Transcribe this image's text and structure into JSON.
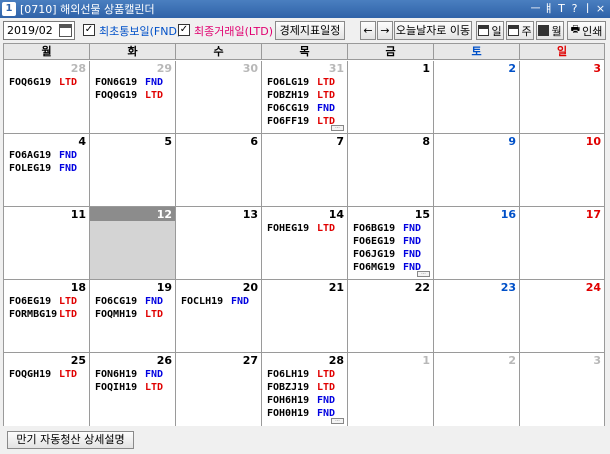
{
  "window": {
    "number": "1",
    "title": "[0710] 해외선물 상품캘린더",
    "controls": [
      "ㅡ",
      "ㅒ",
      "T",
      "?",
      "ㅣ",
      "×"
    ]
  },
  "toolbar": {
    "date_value": "2019/02",
    "fnd_checkbox": {
      "checked": true,
      "label": "최초통보일(FND)"
    },
    "ltd_checkbox": {
      "checked": true,
      "label": "최종거래일(LTD)"
    },
    "economic_button": "경제지표일정",
    "prev_button": "←",
    "next_button": "→",
    "today_button": "오늘날자로 이동",
    "day_button": "일",
    "week_button": "주",
    "month_button": "월",
    "print_button": "인쇄"
  },
  "colors": {
    "sunday": "#e00000",
    "saturday": "#0050c8",
    "ltd": "#e00000",
    "fnd": "#0000e0"
  },
  "weekdays": [
    "월",
    "화",
    "수",
    "목",
    "금",
    "토",
    "일"
  ],
  "weeks": [
    [
      {
        "day": "28",
        "other": true,
        "events": [
          {
            "code": "FOQ6G19",
            "type": "LTD"
          }
        ]
      },
      {
        "day": "29",
        "other": true,
        "events": [
          {
            "code": "FON6G19",
            "type": "FND"
          },
          {
            "code": "FOQ0G19",
            "type": "LTD"
          }
        ]
      },
      {
        "day": "30",
        "other": true,
        "events": []
      },
      {
        "day": "31",
        "other": true,
        "more": true,
        "events": [
          {
            "code": "FO6LG19",
            "type": "LTD"
          },
          {
            "code": "FOBZH19",
            "type": "LTD"
          },
          {
            "code": "FO6CG19",
            "type": "FND"
          },
          {
            "code": "FO6FF19",
            "type": "LTD"
          }
        ]
      },
      {
        "day": "1",
        "events": []
      },
      {
        "day": "2",
        "events": []
      },
      {
        "day": "3",
        "events": []
      }
    ],
    [
      {
        "day": "4",
        "events": [
          {
            "code": "FO6AG19",
            "type": "FND"
          },
          {
            "code": "FOLEG19",
            "type": "FND"
          }
        ]
      },
      {
        "day": "5",
        "events": []
      },
      {
        "day": "6",
        "events": []
      },
      {
        "day": "7",
        "events": []
      },
      {
        "day": "8",
        "events": []
      },
      {
        "day": "9",
        "events": []
      },
      {
        "day": "10",
        "events": []
      }
    ],
    [
      {
        "day": "11",
        "events": []
      },
      {
        "day": "12",
        "today": true,
        "events": []
      },
      {
        "day": "13",
        "events": []
      },
      {
        "day": "14",
        "events": [
          {
            "code": "FOHEG19",
            "type": "LTD"
          }
        ]
      },
      {
        "day": "15",
        "more": true,
        "events": [
          {
            "code": "FO6BG19",
            "type": "FND"
          },
          {
            "code": "FO6EG19",
            "type": "FND"
          },
          {
            "code": "FO6JG19",
            "type": "FND"
          },
          {
            "code": "FO6MG19",
            "type": "FND"
          }
        ]
      },
      {
        "day": "16",
        "events": []
      },
      {
        "day": "17",
        "events": []
      }
    ],
    [
      {
        "day": "18",
        "events": [
          {
            "code": "FO6EG19",
            "type": "LTD"
          },
          {
            "code": "FORMBG19",
            "type": "LTD"
          }
        ]
      },
      {
        "day": "19",
        "events": [
          {
            "code": "FO6CG19",
            "type": "FND"
          },
          {
            "code": "FOQMH19",
            "type": "LTD"
          }
        ]
      },
      {
        "day": "20",
        "events": [
          {
            "code": "FOCLH19",
            "type": "FND"
          }
        ]
      },
      {
        "day": "21",
        "events": []
      },
      {
        "day": "22",
        "events": []
      },
      {
        "day": "23",
        "events": []
      },
      {
        "day": "24",
        "events": []
      }
    ],
    [
      {
        "day": "25",
        "events": [
          {
            "code": "FOQGH19",
            "type": "LTD"
          }
        ]
      },
      {
        "day": "26",
        "events": [
          {
            "code": "FON6H19",
            "type": "FND"
          },
          {
            "code": "FOQIH19",
            "type": "LTD"
          }
        ]
      },
      {
        "day": "27",
        "events": []
      },
      {
        "day": "28",
        "more": true,
        "events": [
          {
            "code": "FO6LH19",
            "type": "LTD"
          },
          {
            "code": "FOBZJ19",
            "type": "LTD"
          },
          {
            "code": "FOH6H19",
            "type": "FND"
          },
          {
            "code": "FOH0H19",
            "type": "FND"
          }
        ]
      },
      {
        "day": "1",
        "other": true,
        "events": []
      },
      {
        "day": "2",
        "other": true,
        "events": []
      },
      {
        "day": "3",
        "other": true,
        "events": []
      }
    ]
  ],
  "footer": {
    "detail_button": "만기 자동청산 상세설명"
  }
}
